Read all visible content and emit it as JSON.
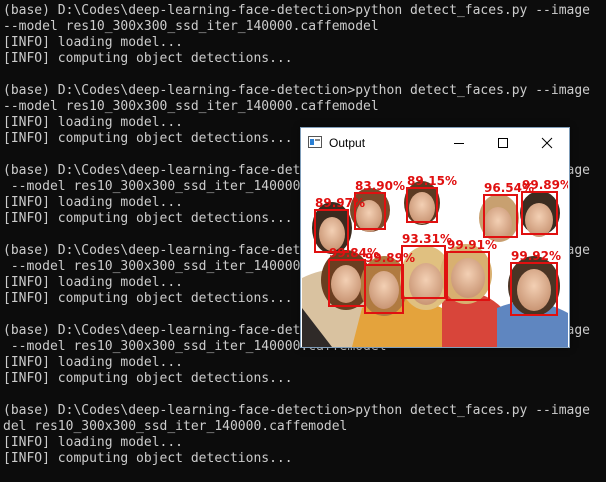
{
  "console": {
    "lines": [
      "(base) D:\\Codes\\deep-learning-face-detection>python detect_faces.py --image",
      "--model res10_300x300_ssd_iter_140000.caffemodel",
      "[INFO] loading model...",
      "[INFO] computing object detections...",
      "",
      "(base) D:\\Codes\\deep-learning-face-detection>python detect_faces.py --image",
      "--model res10_300x300_ssd_iter_140000.caffemodel",
      "[INFO] loading model...",
      "[INFO] computing object detections...",
      "",
      "(base) D:\\Codes\\deep-learning-face-detection>python detect_faces.py --image",
      " --model res10_300x300_ssd_iter_140000.caffemodel",
      "[INFO] loading model...",
      "[INFO] computing object detections...",
      "",
      "(base) D:\\Codes\\deep-learning-face-detection>python detect_faces.py --image",
      " --model res10_300x300_ssd_iter_140000.caffemodel",
      "[INFO] loading model...",
      "[INFO] computing object detections...",
      "",
      "(base) D:\\Codes\\deep-learning-face-detection>python detect_faces.py --image",
      " --model res10_300x300_ssd_iter_140000.caffemodel",
      "[INFO] loading model...",
      "[INFO] computing object detections...",
      "",
      "(base) D:\\Codes\\deep-learning-face-detection>python detect_faces.py --image",
      "del res10_300x300_ssd_iter_140000.caffemodel",
      "[INFO] loading model...",
      "[INFO] computing object detections..."
    ],
    "text_color": "#cccccc",
    "background": "#0c0c0c"
  },
  "window": {
    "title": "Output",
    "detections": [
      "89.97%",
      "83.90%",
      "89.15%",
      "96.54%",
      "99.89%",
      "93.31%",
      "99.84%",
      "99.89%",
      "99.91%",
      "99.92%"
    ],
    "box_color": "#e01010"
  }
}
